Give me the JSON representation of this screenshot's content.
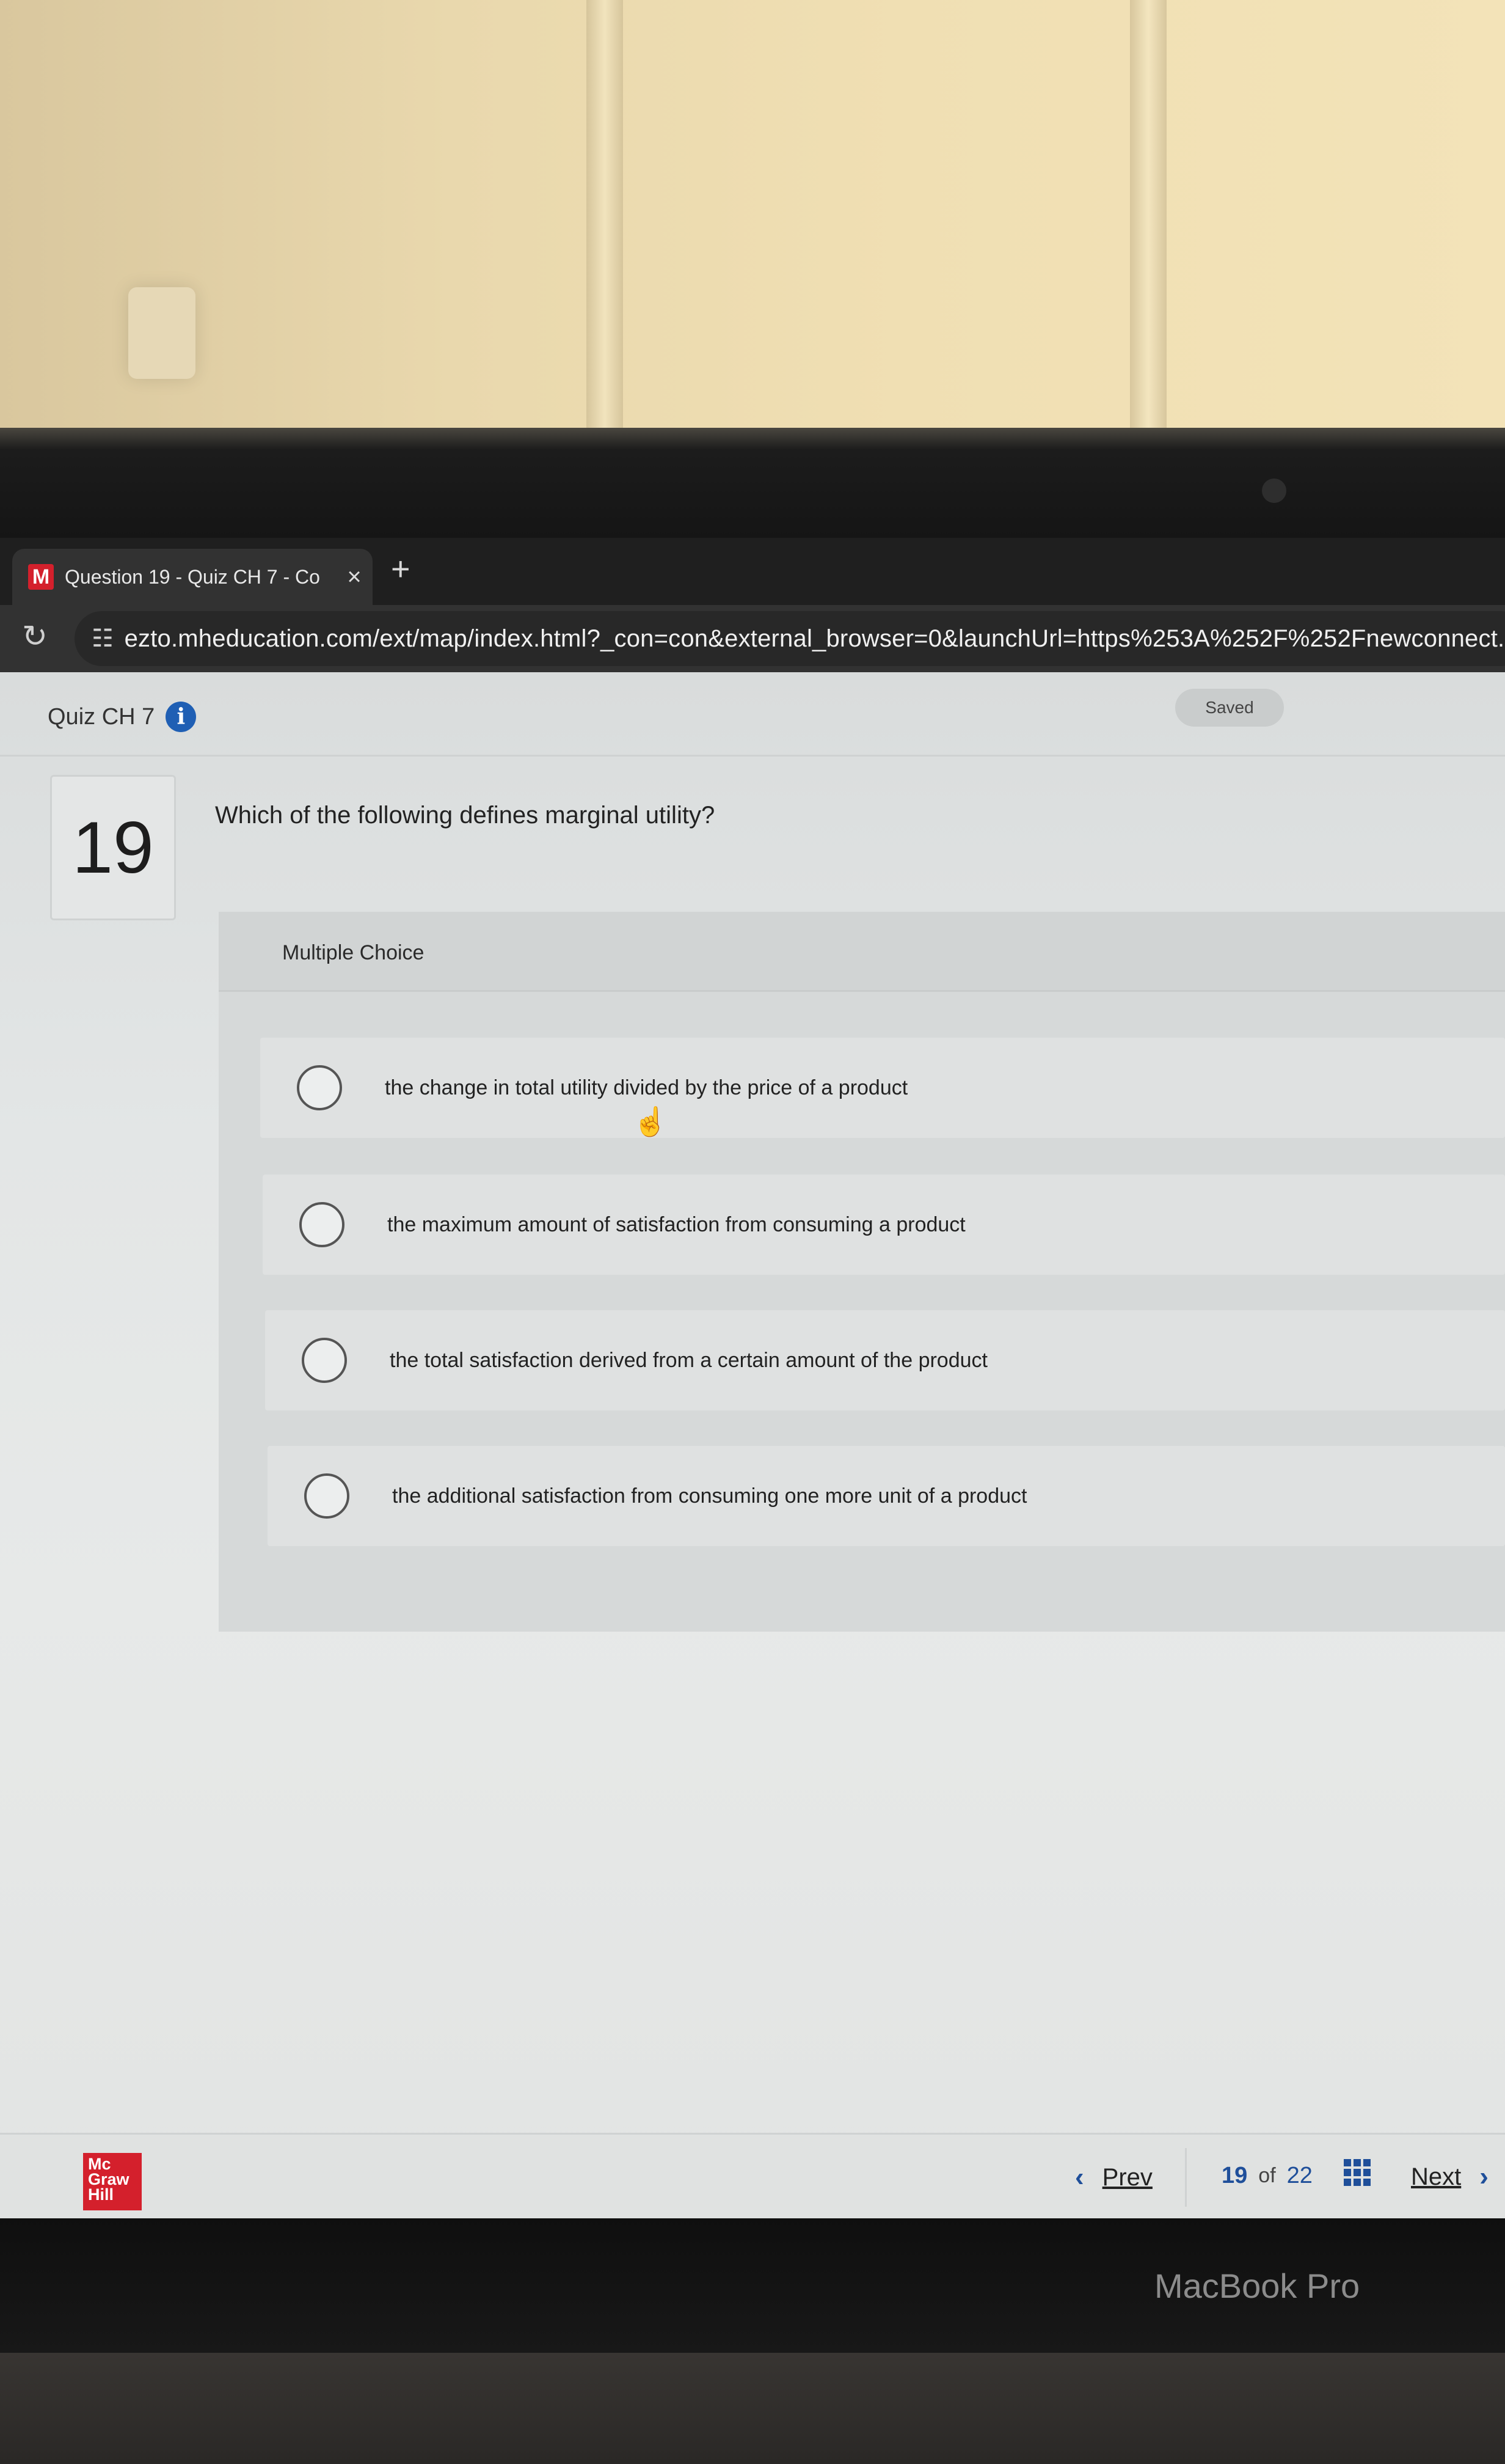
{
  "browser": {
    "tab_favicon": "M",
    "tab_title": "Question 19 - Quiz CH 7 - Co",
    "tab_close": "×",
    "new_tab": "+",
    "url": "ezto.mheducation.com/ext/map/index.html?_con=con&external_browser=0&launchUrl=https%253A%252F%252Fnewconnect.mheduc"
  },
  "quiz": {
    "title": "Quiz CH 7",
    "info_icon": "i",
    "status": "Saved",
    "question_number": "19",
    "question_text": "Which of the following defines marginal utility?",
    "question_type": "Multiple Choice",
    "options": [
      "the change in total utility divided by the price of a product",
      "the maximum amount of satisfaction from consuming a product",
      "the total satisfaction derived from a certain amount of the product",
      "the additional satisfaction from consuming one more unit of a product"
    ]
  },
  "footer": {
    "logo_lines": [
      "Mc",
      "Graw",
      "Hill"
    ],
    "prev_label": "Prev",
    "current_page": "19",
    "of_label": "of",
    "total_pages": "22",
    "next_label": "Next"
  },
  "device": {
    "brand": "MacBook Pro"
  },
  "icons": {
    "reload": "reload-icon",
    "site_settings": "tune-icon",
    "info": "info-icon",
    "grid": "grid-icon",
    "cursor": "hand-pointer-icon"
  },
  "colors": {
    "brand_red": "#d4202c",
    "nav_blue": "#1f4f9a",
    "info_blue": "#1f5fb4"
  }
}
